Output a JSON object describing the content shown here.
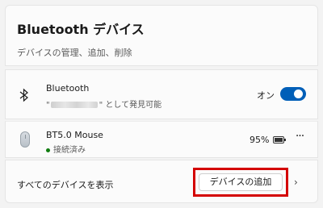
{
  "header": {
    "title": "Bluetooth デバイス",
    "subtitle": "デバイスの管理、追加、削除"
  },
  "bluetooth": {
    "icon": "bluetooth-icon",
    "name": "Bluetooth",
    "detail_prefix": "\"",
    "detail_suffix": "\" として発見可能",
    "toggle_label": "オン",
    "toggle_on": true,
    "accent_color": "#005fb8"
  },
  "device": {
    "icon": "mouse-icon",
    "name": "BT5.0 Mouse",
    "status": "接続済み",
    "status_color": "#107c10",
    "battery": "95%",
    "battery_level": 0.95,
    "more_label": "···"
  },
  "footer": {
    "show_all_label": "すべてのデバイスを表示",
    "add_button_label": "デバイスの追加",
    "chevron": "›",
    "highlight_color": "#d40000"
  }
}
